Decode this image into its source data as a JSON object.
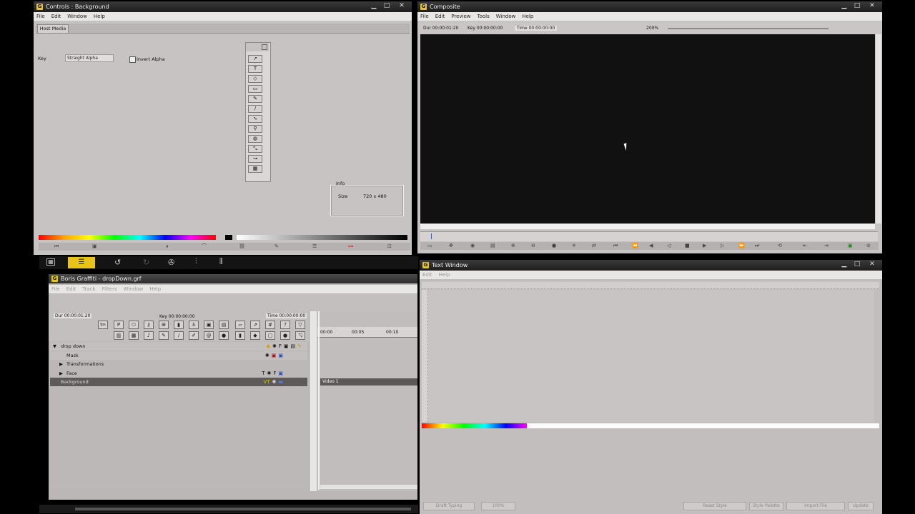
{
  "controls_window": {
    "title": "Controls : Background",
    "menu": [
      "File",
      "Edit",
      "Window",
      "Help"
    ],
    "tab": "Host Media",
    "key_label": "Key",
    "key_value": "Straight Alpha",
    "invert_alpha_label": "Invert Alpha",
    "info_title": "Info",
    "size_label": "Size",
    "size_value": "720 x 480",
    "tools": [
      "arrow-tool-icon",
      "text-tool-icon",
      "shape-tool-icon",
      "rect-tool-icon",
      "pen-tool-icon",
      "brush-tool-icon",
      "spline-tool-icon",
      "zoom-tool-icon",
      "fill-tool-icon",
      "transform-tool-icon",
      "path-tool-icon",
      "grid-tool-icon"
    ]
  },
  "composite_window": {
    "title": "Composite",
    "menu": [
      "File",
      "Edit",
      "Preview",
      "Tools",
      "Window",
      "Help"
    ],
    "dur": "Dur 00:00:01:20",
    "key": "Key 00:00:00:00",
    "time": "Time 00:00:00:00",
    "zoom": "200%"
  },
  "host_toolbar": {
    "icons": [
      "grid-view-icon",
      "timeline-view-icon",
      "undo-icon",
      "redo-icon",
      "effects-icon",
      "audio-icon",
      "audio-mixer-icon"
    ]
  },
  "timeline_window": {
    "title": "Boris Graffiti - dropDown.grf",
    "menu": [
      "File",
      "Edit",
      "Track",
      "Filters",
      "Window",
      "Help"
    ],
    "dur": "Dur 00:00:01:20",
    "key": "Key 00:00:00:00",
    "time": "Time 00:00:00:00",
    "ruler": [
      "00:00",
      "00:05",
      "00:10"
    ],
    "tracks": [
      {
        "label": "drop down",
        "indent": 0,
        "expander": "▼"
      },
      {
        "label": "Mask",
        "indent": 1,
        "expander": ""
      },
      {
        "label": "Transformations",
        "indent": 1,
        "expander": "▶"
      },
      {
        "label": "Face",
        "indent": 1,
        "expander": "▶"
      },
      {
        "label": "Background",
        "indent": 1,
        "expander": ""
      }
    ],
    "video_clip_label": "Video 1"
  },
  "text_window": {
    "title": "Text Window",
    "menu": [
      "Edit",
      "Help"
    ],
    "buttons": [
      "Draft Typing",
      "100%",
      "Reset Style",
      "Style Palette",
      "Import File",
      "Update"
    ]
  },
  "colors": {
    "title_bar": "#1d1d1d",
    "panel": "#c8c3c3",
    "composite_canvas": "#111111",
    "selected_row": "#5e5a5a",
    "highlight_tool": "#e8c31a"
  }
}
